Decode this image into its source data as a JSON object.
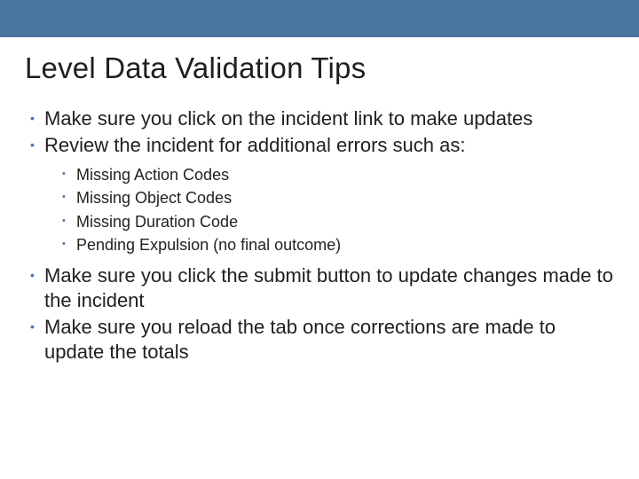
{
  "title": "Level Data Validation Tips",
  "bullets": {
    "b1": "Make sure you click on the incident link to make updates",
    "b2": "Review the incident for additional errors such as:",
    "sub": {
      "s1": "Missing Action Codes",
      "s2": "Missing Object Codes",
      "s3": "Missing Duration Code",
      "s4": "Pending Expulsion (no final outcome)"
    },
    "b3": "Make sure you click the submit button to update changes made to the incident",
    "b4": "Make sure you reload the tab once corrections are made to update the totals"
  },
  "colors": {
    "accent": "#4a75a3"
  }
}
